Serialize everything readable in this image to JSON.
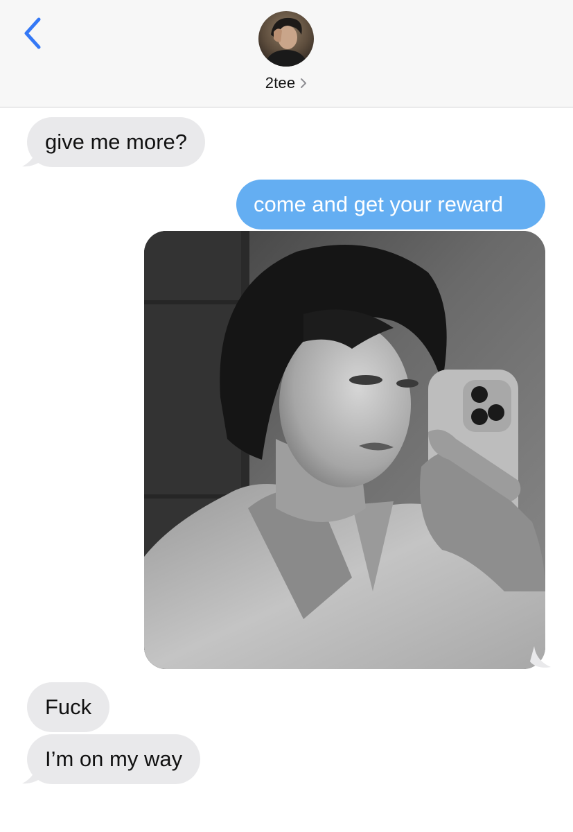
{
  "header": {
    "contact_name": "2tee",
    "back_icon": "chevron-left-icon",
    "contact_chevron_icon": "chevron-right-icon",
    "accent_color": "#3478f6",
    "avatar": "contact-avatar"
  },
  "messages": [
    {
      "direction": "incoming",
      "type": "text",
      "text": "give me more?"
    },
    {
      "direction": "outgoing",
      "type": "text",
      "text": "come and get your reward"
    },
    {
      "direction": "outgoing",
      "type": "image",
      "image": "grayscale-mirror-selfie-photo"
    },
    {
      "direction": "incoming",
      "type": "text",
      "text": "Fuck"
    },
    {
      "direction": "incoming",
      "type": "text",
      "text": "I’m on my way"
    }
  ],
  "colors": {
    "incoming_bubble": "#e9e9eb",
    "outgoing_bubble": "#64aef2",
    "header_bg": "#f7f7f7"
  }
}
